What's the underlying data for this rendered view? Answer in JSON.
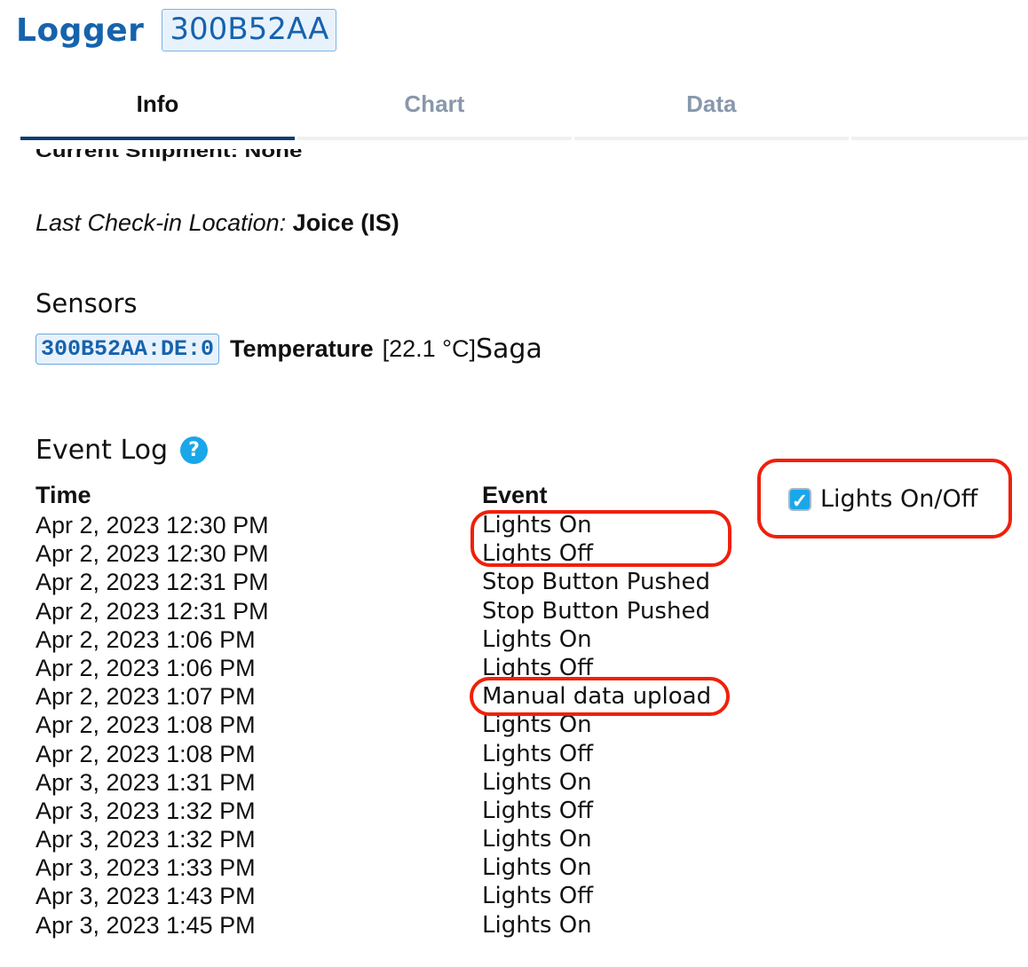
{
  "header": {
    "title": "Logger",
    "logger_id": "300B52AA"
  },
  "tabs": [
    {
      "label": "Info",
      "active": true
    },
    {
      "label": "Chart",
      "active": false
    },
    {
      "label": "Data",
      "active": false
    }
  ],
  "info": {
    "current_shipment_clipped": "Current Shipment: None",
    "last_checkin_label": "Last Check-in Location:",
    "last_checkin_value": "Joice (IS)"
  },
  "sensors": {
    "heading": "Sensors",
    "items": [
      {
        "id": "300B52AA:DE:0",
        "type": "Temperature",
        "value": "[22.1 °C]",
        "name": "Saga"
      }
    ]
  },
  "event_log": {
    "heading": "Event Log",
    "help_icon": "?",
    "columns": {
      "time": "Time",
      "event": "Event"
    },
    "filter": {
      "label": "Lights On/Off",
      "checked": true,
      "check_glyph": "✓"
    },
    "rows": [
      {
        "time": "Apr 2, 2023 12:30 PM",
        "event": "Lights On"
      },
      {
        "time": "Apr 2, 2023 12:30 PM",
        "event": "Lights Off"
      },
      {
        "time": "Apr 2, 2023 12:31 PM",
        "event": "Stop Button Pushed"
      },
      {
        "time": "Apr 2, 2023 12:31 PM",
        "event": "Stop Button Pushed"
      },
      {
        "time": "Apr 2, 2023 1:06 PM",
        "event": "Lights On"
      },
      {
        "time": "Apr 2, 2023 1:06 PM",
        "event": "Lights Off"
      },
      {
        "time": "Apr 2, 2023 1:07 PM",
        "event": "Manual data upload"
      },
      {
        "time": "Apr 2, 2023 1:08 PM",
        "event": "Lights On"
      },
      {
        "time": "Apr 2, 2023 1:08 PM",
        "event": "Lights Off"
      },
      {
        "time": "Apr 3, 2023 1:31 PM",
        "event": "Lights On"
      },
      {
        "time": "Apr 3, 2023 1:32 PM",
        "event": "Lights Off"
      },
      {
        "time": "Apr 3, 2023 1:32 PM",
        "event": "Lights On"
      },
      {
        "time": "Apr 3, 2023 1:33 PM",
        "event": "Lights On"
      },
      {
        "time": "Apr 3, 2023 1:43 PM",
        "event": "Lights Off"
      },
      {
        "time": "Apr 3, 2023 1:45 PM",
        "event": "Lights On"
      }
    ]
  },
  "annotations": {
    "color": "#f0200a"
  }
}
